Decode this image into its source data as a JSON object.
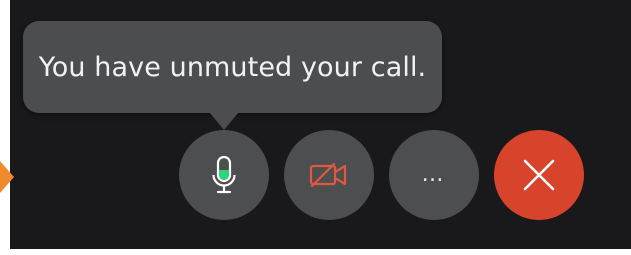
{
  "tooltip": {
    "message": "You have unmuted your call."
  },
  "controls": {
    "mic": {
      "icon": "microphone-icon",
      "state": "unmuted",
      "level_color": "#2bd57a"
    },
    "video": {
      "icon": "video-off-icon",
      "state": "off",
      "icon_color": "#e0593f"
    },
    "more": {
      "icon": "more-dots-icon",
      "glyph": "…"
    },
    "end": {
      "icon": "close-icon",
      "color": "#d8432b"
    }
  },
  "colors": {
    "surface": "#19191b",
    "button": "#4c4e50",
    "accent_arrow": "#ef8a2d"
  }
}
